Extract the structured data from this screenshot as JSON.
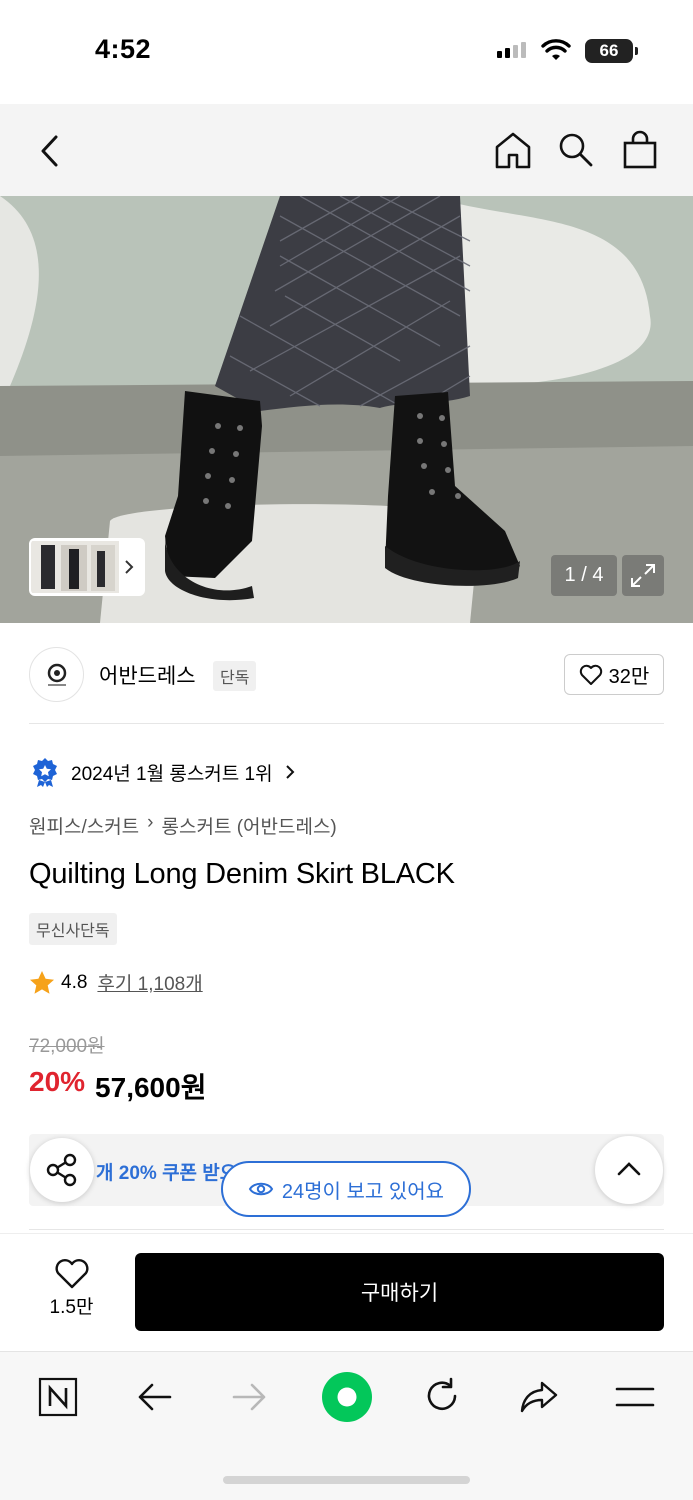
{
  "status_bar": {
    "time": "4:52",
    "battery": "66"
  },
  "gallery": {
    "counter": "1 / 4"
  },
  "brand": {
    "name": "어반드레스",
    "exclusive_label": "단독",
    "likes": "32만"
  },
  "ranking": {
    "text": "2024년 1월 롱스커트 1위"
  },
  "breadcrumb": {
    "category": "원피스/스커트",
    "subcategory": "롱스커트 (어반드레스)"
  },
  "product": {
    "title": "Quilting Long Denim Skirt BLACK",
    "tag": "무신사단독",
    "rating": "4.8",
    "reviews": "후기 1,108개",
    "original_price": "72,000원",
    "discount": "20%",
    "sale_price": "57,600원"
  },
  "coupon": {
    "text": "개 20% 쿠폰 받으러 가기"
  },
  "viewers": {
    "text": "24명이 보고 있어요"
  },
  "purchase_bar": {
    "wish_count": "1.5만",
    "buy_label": "구매하기"
  },
  "colors": {
    "discount_red": "#e0242f",
    "link_blue": "#2d6fd6",
    "naver_green": "#03c75a"
  }
}
